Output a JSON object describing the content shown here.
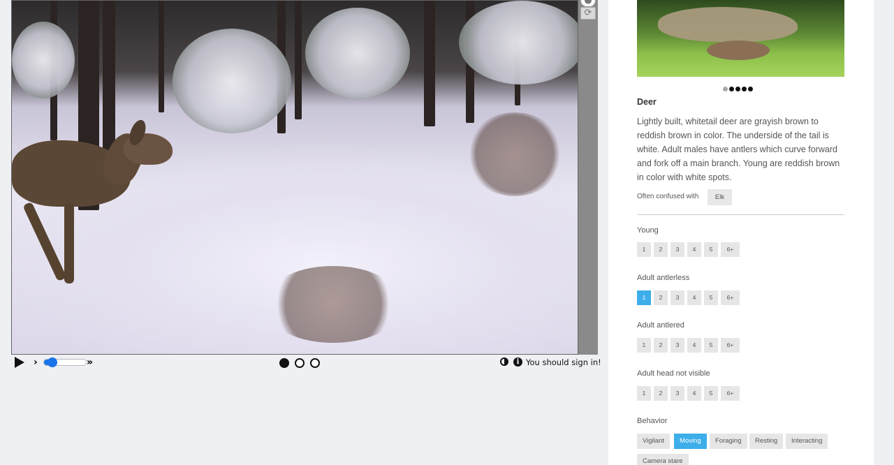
{
  "viewer": {
    "image_description_icon": "camera-trap-photo",
    "strip_buttons": [
      {
        "icon": "circle-icon"
      },
      {
        "icon": "refresh-icon"
      }
    ],
    "controls": {
      "play_icon": "play-icon",
      "step_back_label": "›",
      "fast_forward_label": "»",
      "frames": [
        true,
        false,
        false
      ],
      "signin_text": "You should sign in!"
    }
  },
  "panel": {
    "species": {
      "title": "Deer",
      "description": "Lightly built, whitetail deer are grayish brown to reddish brown in color. The underside of the tail is white. Adult males have antlers which curve forward and fork off a main branch. Young are reddish brown in color with white spots.",
      "confused_label": "Often confused with",
      "confused_with": "Elk"
    },
    "questions": [
      {
        "label": "Young",
        "options": [
          "1",
          "2",
          "3",
          "4",
          "5",
          "6+"
        ],
        "selected": null
      },
      {
        "label": "Adult antlerless",
        "options": [
          "1",
          "2",
          "3",
          "4",
          "5",
          "6+"
        ],
        "selected": "1"
      },
      {
        "label": "Adult antlered",
        "options": [
          "1",
          "2",
          "3",
          "4",
          "5",
          "6+"
        ],
        "selected": null
      },
      {
        "label": "Adult head not visible",
        "options": [
          "1",
          "2",
          "3",
          "4",
          "5",
          "6+"
        ],
        "selected": null
      }
    ],
    "behavior": {
      "label": "Behavior",
      "options": [
        "Vigilant",
        "Moving",
        "Foraging",
        "Resting",
        "Interacting",
        "Camera stare"
      ],
      "selected": "Moving"
    },
    "colors": {
      "accent": "#3daee9"
    }
  }
}
